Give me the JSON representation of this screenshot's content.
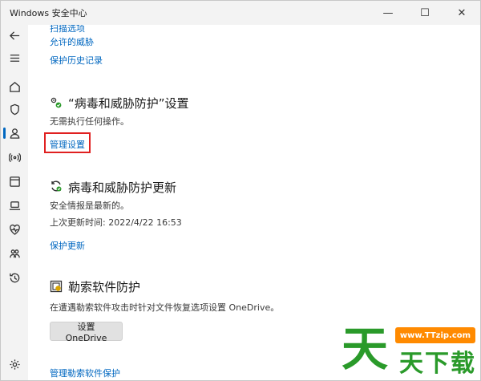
{
  "window": {
    "title": "Windows 安全中心"
  },
  "controls": {
    "minimize": "—",
    "maximize": "☐",
    "close": "✕"
  },
  "top_links": {
    "scan_options": "扫描选项",
    "allowed_threats": "允许的威胁",
    "protection_history": "保护历史记录"
  },
  "settings_section": {
    "heading": "“病毒和威胁防护”设置",
    "status": "无需执行任何操作。",
    "link": "管理设置"
  },
  "updates_section": {
    "heading": "病毒和威胁防护更新",
    "status": "安全情报是最新的。",
    "last_update": "上次更新时间: 2022/4/22 16:53",
    "link": "保护更新"
  },
  "ransomware_section": {
    "heading": "勒索软件防护",
    "description": "在遭遇勒索软件攻击时针对文件恢复选项设置 OneDrive。",
    "button": "设置 OneDrive",
    "link": "管理勒索软件保护"
  },
  "watermark": {
    "char1": "天",
    "char2": "天",
    "char3": "下",
    "char4": "载",
    "url": "www.TTzip.com"
  },
  "colors": {
    "link": "#0067c0",
    "highlight": "#e02020",
    "watermark_green": "#2a9a2a",
    "watermark_orange": "#ff8a00"
  }
}
